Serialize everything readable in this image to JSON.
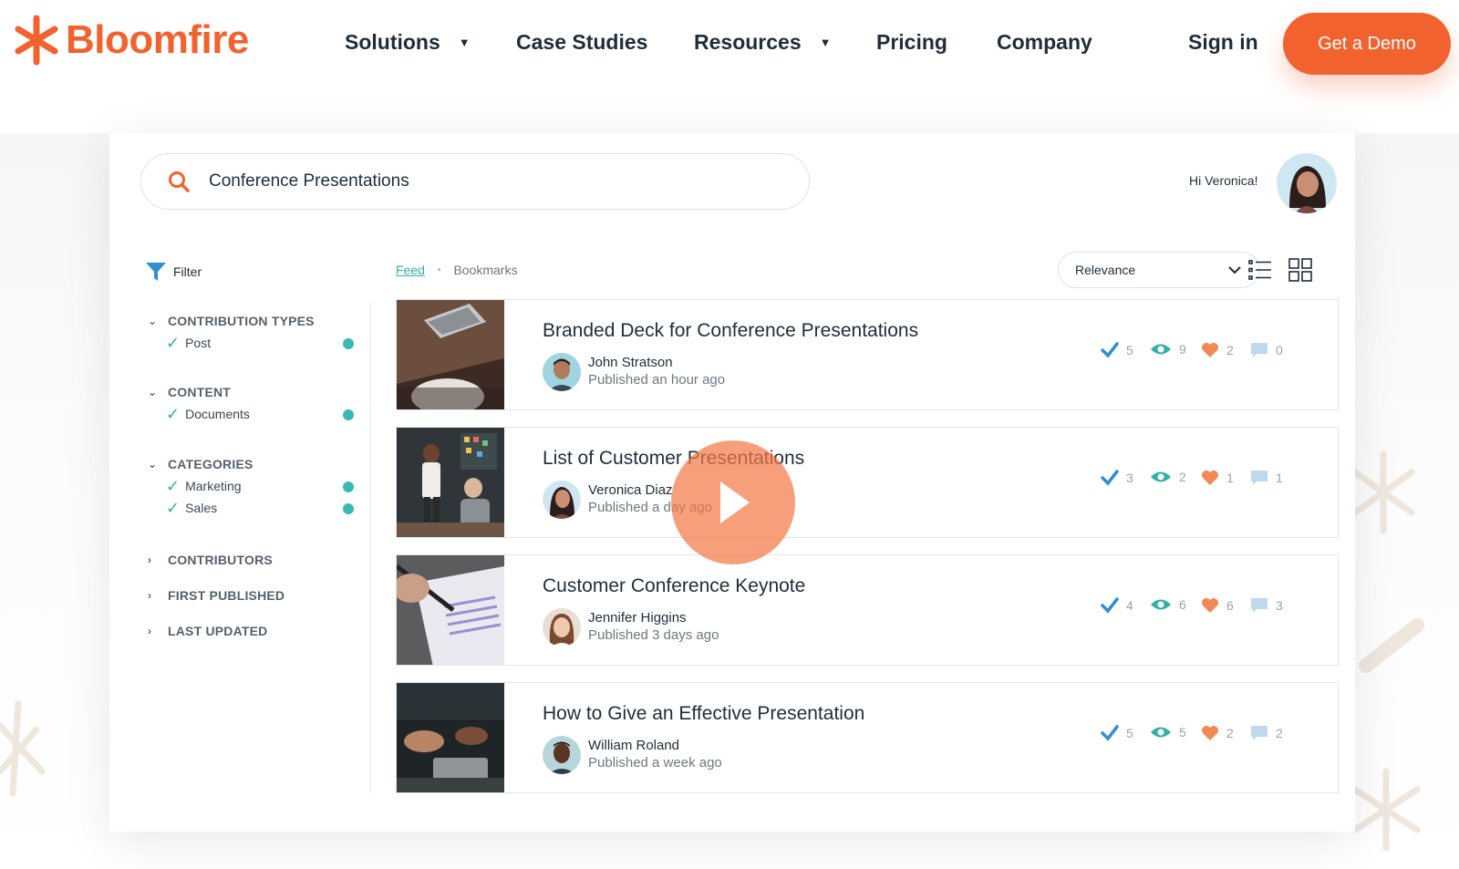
{
  "brand": {
    "name": "Bloomfire",
    "color": "#f2622e"
  },
  "nav": {
    "items": [
      {
        "label": "Solutions",
        "has_menu": true
      },
      {
        "label": "Case Studies",
        "has_menu": false
      },
      {
        "label": "Resources",
        "has_menu": true
      },
      {
        "label": "Pricing",
        "has_menu": false
      },
      {
        "label": "Company",
        "has_menu": false
      }
    ],
    "menu_caret": "▼",
    "sign_in": "Sign in",
    "cta": "Get a Demo"
  },
  "app": {
    "search": {
      "value": "Conference Presentations",
      "icon": "search-icon"
    },
    "greeting": "Hi Veronica!",
    "filter": {
      "label": "Filter",
      "groups": [
        {
          "title": "CONTRIBUTION TYPES",
          "expanded": true,
          "options": [
            {
              "label": "Post",
              "checked": true
            }
          ]
        },
        {
          "title": "CONTENT",
          "expanded": true,
          "options": [
            {
              "label": "Documents",
              "checked": true
            }
          ]
        },
        {
          "title": "CATEGORIES",
          "expanded": true,
          "options": [
            {
              "label": "Marketing",
              "checked": true
            },
            {
              "label": "Sales",
              "checked": true
            }
          ]
        },
        {
          "title": "CONTRIBUTORS",
          "expanded": false,
          "options": []
        },
        {
          "title": "FIRST PUBLISHED",
          "expanded": false,
          "options": []
        },
        {
          "title": "LAST UPDATED",
          "expanded": false,
          "options": []
        }
      ],
      "chevron_open": "⌄",
      "chevron_closed": "›",
      "check_glyph": "✓"
    },
    "crumbs": {
      "feed": "Feed",
      "separator": "•",
      "bookmarks": "Bookmarks"
    },
    "sort": {
      "selected": "Relevance",
      "caret": "⌄"
    },
    "posts": [
      {
        "title": "Branded Deck for Conference Presentations",
        "author": "John Stratson",
        "published": "Published an hour ago",
        "stats": {
          "checks": "5",
          "views": "9",
          "likes": "2",
          "comments": "0"
        }
      },
      {
        "title": "List of Customer Presentations",
        "author": "Veronica Diaz",
        "published": "Published a day ago",
        "stats": {
          "checks": "3",
          "views": "2",
          "likes": "1",
          "comments": "1"
        }
      },
      {
        "title": "Customer Conference Keynote",
        "author": "Jennifer Higgins",
        "published": "Published 3 days ago",
        "stats": {
          "checks": "4",
          "views": "6",
          "likes": "6",
          "comments": "3"
        }
      },
      {
        "title": "How to Give an Effective Presentation",
        "author": "William Roland",
        "published": "Published a week ago",
        "stats": {
          "checks": "5",
          "views": "5",
          "likes": "2",
          "comments": "2"
        }
      }
    ]
  },
  "colors": {
    "accent": "#f2622e",
    "teal": "#2fb1aa",
    "check_blue": "#2f8fd0",
    "heart": "#f08a52",
    "comment": "#bfd9ec"
  }
}
